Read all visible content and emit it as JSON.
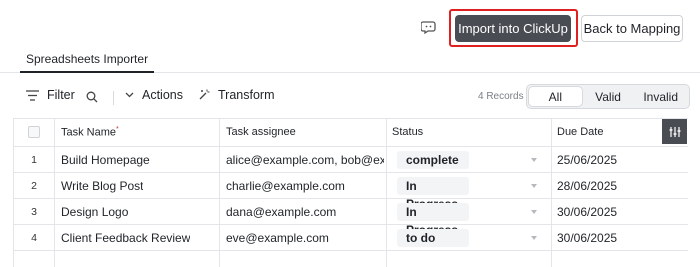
{
  "header": {
    "import_label": "Import into ClickUp",
    "back_label": "Back to Mapping"
  },
  "tabs": [
    {
      "label": "Spreadsheets Importer",
      "active": true
    }
  ],
  "toolbar": {
    "filter_label": "Filter",
    "actions_label": "Actions",
    "transform_label": "Transform",
    "records_count": "4 Records",
    "segments": [
      {
        "label": "All",
        "active": true
      },
      {
        "label": "Valid",
        "active": false
      },
      {
        "label": "Invalid",
        "active": false
      }
    ]
  },
  "table": {
    "columns": [
      {
        "label": "Task Name",
        "required_mark": "*"
      },
      {
        "label": "Task assignee",
        "required_mark": ""
      },
      {
        "label": "Status",
        "required_mark": ""
      },
      {
        "label": "Due Date",
        "required_mark": ""
      }
    ],
    "rows": [
      {
        "num": "1",
        "task": "Build Homepage",
        "assignee": "alice@example.com, bob@exa...",
        "status": "complete",
        "due": "25/06/2025"
      },
      {
        "num": "2",
        "task": "Write Blog Post",
        "assignee": "charlie@example.com",
        "status": "In Progress",
        "due": "28/06/2025"
      },
      {
        "num": "3",
        "task": "Design Logo",
        "assignee": "dana@example.com",
        "status": "In Progress",
        "due": "30/06/2025"
      },
      {
        "num": "4",
        "task": "Client Feedback Review",
        "assignee": "eve@example.com",
        "status": "to do",
        "due": "30/06/2025"
      }
    ]
  },
  "colors": {
    "primary_button": "#4a4c54",
    "highlight": "#e02020",
    "grid_line": "#e3e5e8"
  },
  "icons": {
    "feedback": "chat-bubble-icon",
    "filter": "filter-lines-icon",
    "search": "search-icon",
    "actions": "chevron-down-icon",
    "transform": "magic-wand-icon",
    "column_settings": "sliders-icon"
  }
}
